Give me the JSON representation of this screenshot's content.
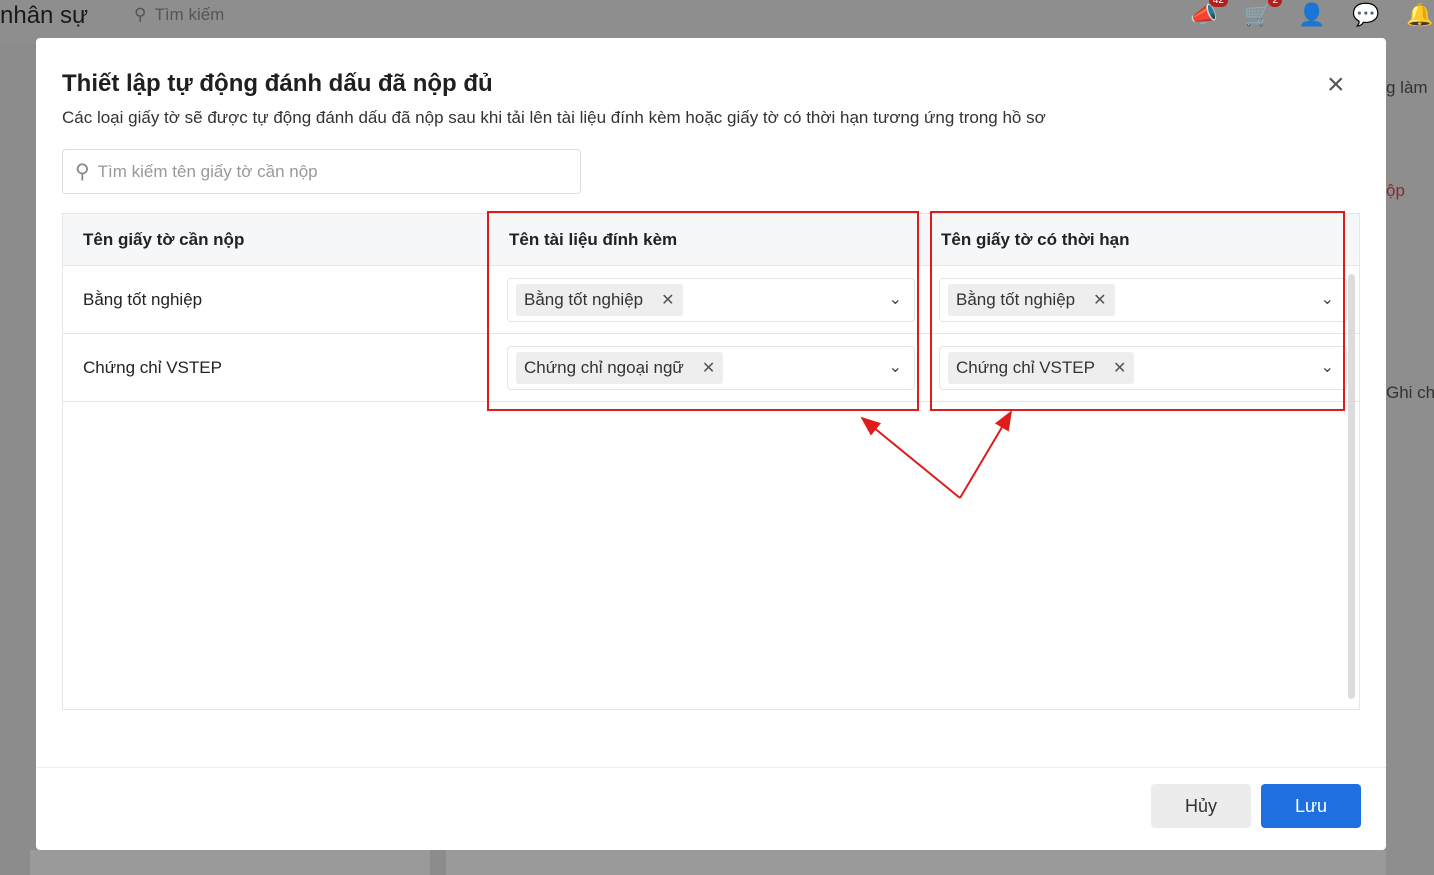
{
  "app": {
    "title": "nhân sự",
    "search_placeholder": "Tìm kiếm",
    "badges": {
      "announcements": "42",
      "cart": "2"
    }
  },
  "background": {
    "right_texts": [
      "g làm",
      "ộp",
      "Ghi chú"
    ]
  },
  "modal": {
    "title": "Thiết lập tự động đánh dấu đã nộp đủ",
    "subtitle": "Các loại giấy tờ sẽ được tự động đánh dấu đã nộp sau khi tải lên tài liệu đính kèm hoặc giấy tờ có thời hạn tương ứng trong hồ sơ",
    "search_placeholder": "Tìm kiếm tên giấy tờ cần nộp",
    "columns": [
      "Tên giấy tờ cần nộp",
      "Tên tài liệu đính kèm",
      "Tên giấy tờ có thời hạn"
    ],
    "rows": [
      {
        "name": "Bằng tốt nghiệp",
        "attachment": "Bằng tốt nghiệp",
        "term_doc": "Bằng tốt nghiệp"
      },
      {
        "name": "Chứng chỉ VSTEP",
        "attachment": "Chứng chỉ ngoại ngữ",
        "term_doc": "Chứng chỉ VSTEP"
      }
    ],
    "cancel_label": "Hủy",
    "save_label": "Lưu"
  }
}
